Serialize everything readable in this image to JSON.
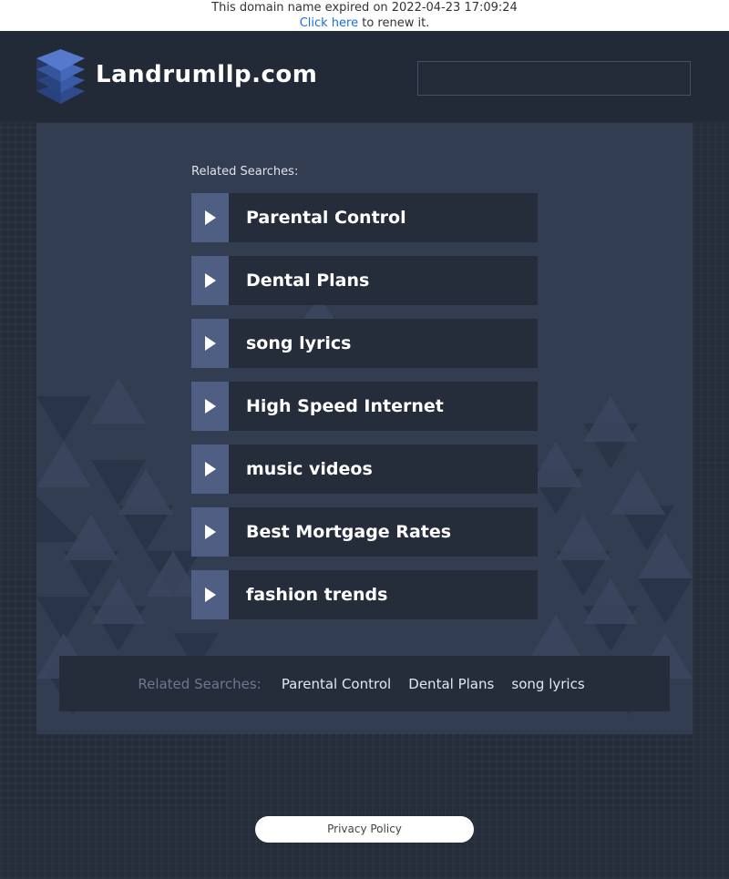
{
  "notice": {
    "expired_text": "This domain name expired on 2022-04-23 17:09:24",
    "renew_link": "Click here",
    "renew_suffix": " to renew it."
  },
  "header": {
    "site_title": "Landrumllp.com",
    "search_value": ""
  },
  "related": {
    "label": "Related Searches:",
    "items": [
      "Parental Control",
      "Dental Plans",
      "song lyrics",
      "High Speed Internet",
      "music videos",
      "Best Mortgage Rates",
      "fashion trends"
    ]
  },
  "bottom_related": {
    "label": "Related Searches:",
    "items": [
      "Parental Control",
      "Dental Plans",
      "song lyrics"
    ]
  },
  "footer": {
    "privacy_label": "Privacy Policy"
  },
  "colors": {
    "page_bg": "#252c3a",
    "panel_bg": "#323d52",
    "arrow_box": "#4f5f83",
    "link_bg": "#252c3a"
  },
  "icons": {
    "logo": "stacked-layers-icon",
    "arrow": "play-arrow-icon"
  }
}
